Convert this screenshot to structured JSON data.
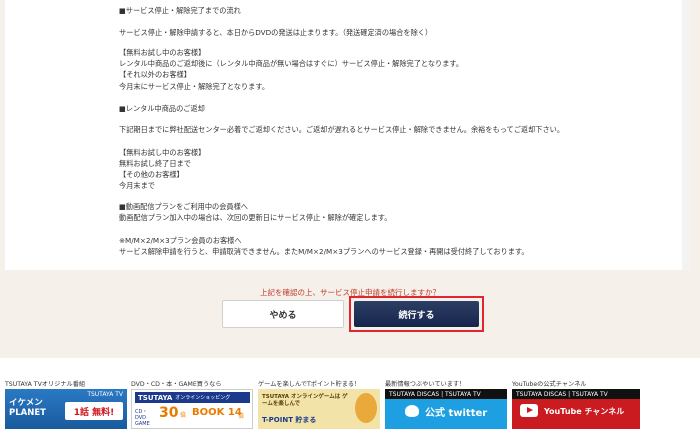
{
  "content": {
    "lines": [
      "■サービス停止・解除完了までの流れ",
      "サービス停止・解除申請すると、本日からDVDの発送は止まります。（発送確定済の場合を除く）",
      "【無料お試し中のお客様】",
      "レンタル中商品のご返却後に（レンタル中商品が無い場合はすぐに）サービス停止・解除完了となります。",
      "【それ以外のお客様】",
      "今月末にサービス停止・解除完了となります。",
      "■レンタル中商品のご返却",
      "下記期日までに弊社配送センター必着でご返却ください。ご返却が遅れるとサービス停止・解除できません。余裕をもってご返却下さい。",
      "【無料お試し中のお客様】",
      "無料お試し終了日まで",
      "【その他のお客様】",
      "今月末まで",
      "■動画配信プランをご利用中の会員様へ",
      "動画配信プラン加入中の場合は、次回の更新日にサービス停止・解除が確定します。",
      "※M/M×2/M×3プラン会員のお客様へ",
      "サービス解除申請を行うと、申請取消できません。またM/M×2/M×3プランへのサービス登録・再開は受付終了しております。"
    ]
  },
  "confirm": {
    "question": "上記を確認の上、サービス停止申請を続行しますか？",
    "cancel_label": "やめる",
    "continue_label": "続行する"
  },
  "footer": {
    "labels": [
      "TSUTAYA TVオリジナル番組",
      "DVD・CD・本・GAME買うなら",
      "ゲームを楽しんでTポイント貯まる！",
      "最新情報つぶやいています！",
      "YouTubeの公式チャンネル"
    ],
    "banners": {
      "b1": {
        "title": "イケメン PLANET",
        "badge": "1話 無料!",
        "brand": "TSUTAYA TV"
      },
      "b2": {
        "brand": "TSUTAYA",
        "sub": "オンラインショッピング",
        "cats": "CD・DVD GAME",
        "n1": "30",
        "pct1": "倍",
        "n2": "BOOK 14",
        "pct2": "倍"
      },
      "b3": {
        "title": "TSUTAYA オンラインゲームは ゲームを楽しんで",
        "pt": "T-POINT 貯まる"
      },
      "b4": {
        "head": "TSUTAYA DISCAS | TSUTAYA TV",
        "label": "公式 twitter"
      },
      "b5": {
        "head": "TSUTAYA DISCAS | TSUTAYA TV",
        "label": "YouTube チャンネル"
      }
    },
    "colors": {
      "twitter": "#1d9fe2",
      "youtube": "#c91b20",
      "cta_border": "#e0262f",
      "cta_bg": "#1c2b52"
    }
  }
}
